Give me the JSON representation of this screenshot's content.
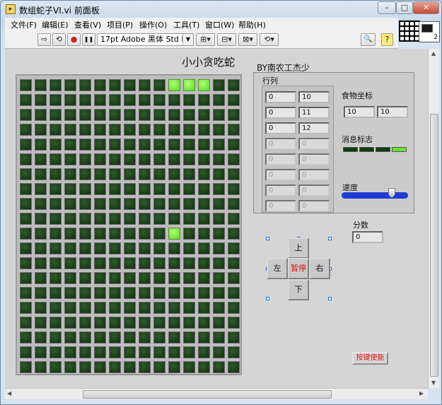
{
  "window": {
    "title": "数组蛇子VI.vi 前面板",
    "app_icon": "labview-vi-icon"
  },
  "window_controls": {
    "minimize": "–",
    "maximize": "□",
    "close": "✕"
  },
  "menu": [
    "文件(F)",
    "编辑(E)",
    "查看(V)",
    "项目(P)",
    "操作(O)",
    "工具(T)",
    "窗口(W)",
    "帮助(H)"
  ],
  "toolbar": {
    "run": "⇨",
    "run_continuous": "⟲",
    "abort": "●",
    "pause": "❚❚",
    "font": "17pt Adobe 黑体 Std R",
    "align": "⊞▾",
    "distribute": "⊟▾",
    "resize": "⊠▾",
    "reorder": "⟲▾",
    "search": "🔍",
    "help": "?"
  },
  "front_panel": {
    "game_title": "小小贪吃蛇",
    "author": "BY南农工杰少",
    "array_label": "行列",
    "rows": [
      [
        "0",
        "10"
      ],
      [
        "0",
        "11"
      ],
      [
        "0",
        "12"
      ],
      [
        "0",
        "0"
      ],
      [
        "0",
        "0"
      ],
      [
        "0",
        "0"
      ],
      [
        "0",
        "0"
      ],
      [
        "0",
        "0"
      ]
    ],
    "active_rows": 3,
    "food_label": "食物坐标",
    "food": [
      "10",
      "10"
    ],
    "msg_label": "消息标志",
    "msg_leds": [
      false,
      false,
      false,
      true
    ],
    "speed_label": "速度",
    "speed_fraction": 0.75,
    "score_label": "分数",
    "score": "0",
    "direction": {
      "up": "上",
      "down": "下",
      "left": "左",
      "right": "右",
      "pause": "暂停"
    },
    "enable_button": "按键使能"
  },
  "grid": {
    "cols": 15,
    "rows": 20,
    "lit": [
      [
        0,
        10
      ],
      [
        0,
        11
      ],
      [
        0,
        12
      ],
      [
        10,
        10
      ]
    ]
  },
  "colors": {
    "led_on": "#66e22e",
    "led_off": "#123012",
    "accent_red": "#e01010",
    "slider": "#1f3bd6"
  }
}
